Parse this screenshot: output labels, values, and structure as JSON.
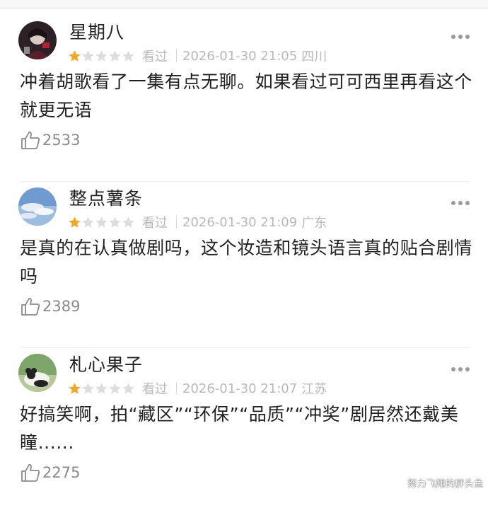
{
  "colors": {
    "star_filled": "#f5a623",
    "star_empty": "#dddddd",
    "meta_text": "#b8b8b8",
    "like_text": "#8a8a8a"
  },
  "comments": [
    {
      "username": "星期八",
      "avatar_icon": "avatar-dark-portrait",
      "rating": 1,
      "rating_max": 5,
      "status": "看过",
      "datetime": "2026-01-30 21:05",
      "location": "四川",
      "text": "冲着胡歌看了一集有点无聊。如果看过可可西里再看这个就更无语",
      "likes": "2533"
    },
    {
      "username": "整点薯条",
      "avatar_icon": "avatar-sky-clouds",
      "rating": 1,
      "rating_max": 5,
      "status": "看过",
      "datetime": "2026-01-30 21:09",
      "location": "广东",
      "text": "是真的在认真做剧吗，这个妆造和镜头语言真的贴合剧情吗",
      "likes": "2389"
    },
    {
      "username": "札心果子",
      "avatar_icon": "avatar-panda",
      "rating": 1,
      "rating_max": 5,
      "status": "看过",
      "datetime": "2026-01-30 21:07",
      "location": "江苏",
      "text": "好搞笑啊，拍“藏区”“环保”“品质”“冲奖”剧居然还戴美瞳......",
      "likes": "2275"
    }
  ],
  "watermark": "努力飞翔的胖头鱼"
}
